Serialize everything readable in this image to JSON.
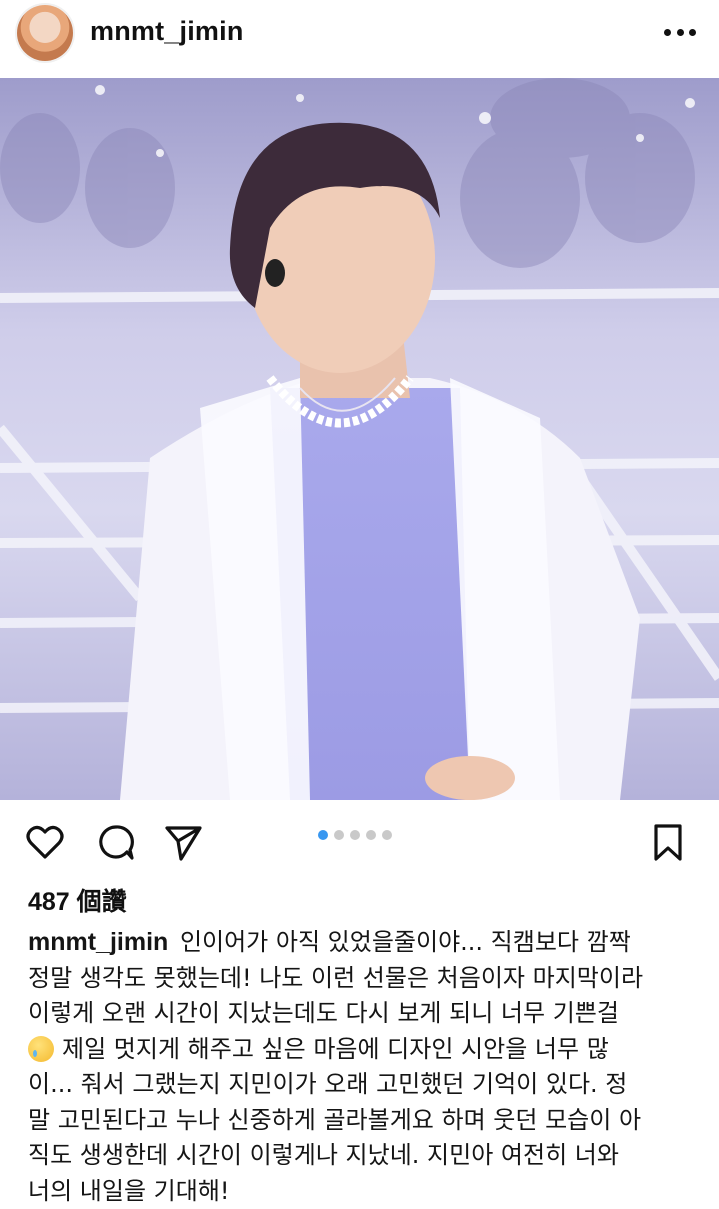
{
  "post": {
    "username": "mnmt_jimin",
    "likes_text": "487 個讚",
    "caption_username": "mnmt_jimin",
    "caption_lines": [
      "인이어가 아직 있었을줄이야... 직캠보다 깜짝",
      "정말 생각도 못했는데! 나도 이런 선물은 처음이자 마지막이라",
      "이렇게 오랜 시간이 지났는데도 다시 보게 되니 너무 기쁜걸",
      "제일 멋지게 해주고 싶은 마음에 디자인 시안을 너무 많",
      "이... 줘서 그랬는지 지민이가 오래 고민했던 기억이 있다. 정",
      "말 고민된다고 누나 신중하게 골라볼게요 하며 웃던 모습이 아",
      "직도 생생한데 시간이 이렇게나 지났네. 지민아 여전히 너와",
      "너의 내일을 기대해!"
    ],
    "carousel": {
      "total": 5,
      "active_index": 1
    }
  },
  "icons": {
    "more": "more-options-icon",
    "like": "heart-icon",
    "comment": "comment-icon",
    "share": "send-icon",
    "save": "bookmark-icon",
    "emoji": "sad-tear-emoji"
  },
  "colors": {
    "accent": "#3897f0",
    "text": "#111111"
  }
}
